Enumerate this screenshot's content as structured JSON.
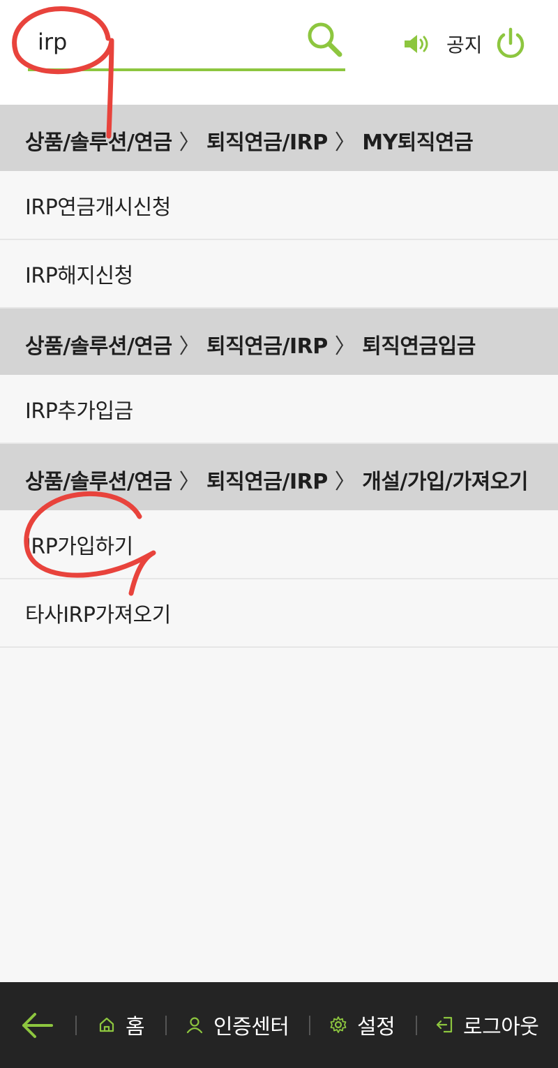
{
  "search": {
    "value": "irp",
    "placeholder": ""
  },
  "header": {
    "notice_label": "공지"
  },
  "results": [
    {
      "breadcrumb": [
        "상품/솔루션/연금",
        "퇴직연금/IRP",
        "MY퇴직연금"
      ],
      "items": [
        "IRP연금개시신청",
        "IRP해지신청"
      ]
    },
    {
      "breadcrumb": [
        "상품/솔루션/연금",
        "퇴직연금/IRP",
        "퇴직연금입금"
      ],
      "items": [
        "IRP추가입금"
      ]
    },
    {
      "breadcrumb": [
        "상품/솔루션/연금",
        "퇴직연금/IRP",
        "개설/가입/가져오기"
      ],
      "items": [
        "IRP가입하기",
        "타사IRP가져오기"
      ]
    }
  ],
  "breadcrumb_separator": "〉",
  "bottom_nav": {
    "home_label": "홈",
    "auth_label": "인증센터",
    "settings_label": "설정",
    "logout_label": "로그아웃"
  },
  "colors": {
    "accent_green": "#8dc63f",
    "annotation_red": "#e8433c",
    "bottom_bar": "#242424",
    "section_header_bg": "#d4d4d4"
  }
}
